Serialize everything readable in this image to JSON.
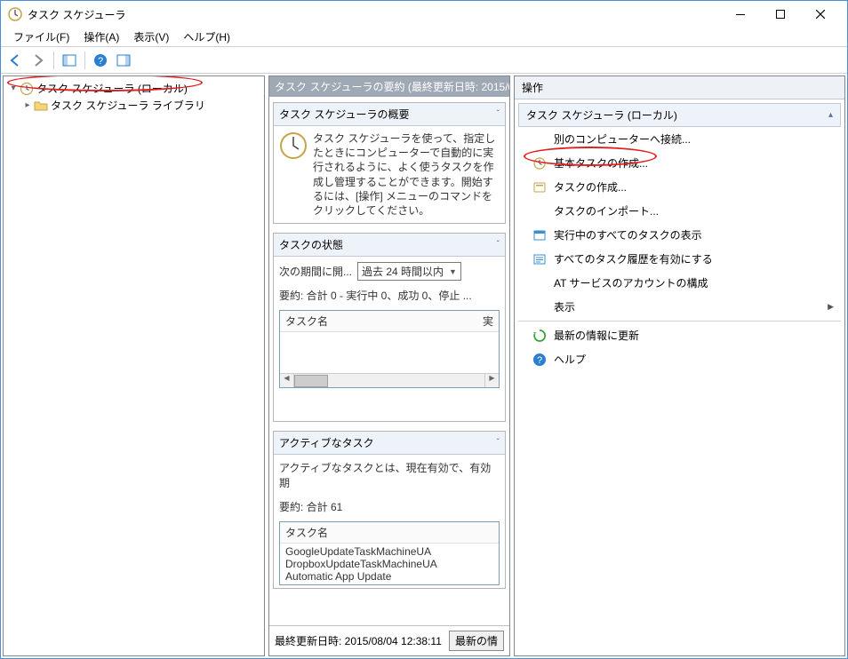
{
  "titlebar": {
    "title": "タスク スケジューラ"
  },
  "menubar": [
    "ファイル(F)",
    "操作(A)",
    "表示(V)",
    "ヘルプ(H)"
  ],
  "tree": {
    "root": {
      "label": "タスク スケジューラ (ローカル)"
    },
    "child": {
      "label": "タスク スケジューラ ライブラリ"
    }
  },
  "center": {
    "header": "タスク スケジューラの要約 (最終更新日時: 2015/08/04",
    "overview_title": "タスク スケジューラの概要",
    "overview_text": "タスク スケジューラを使って、指定したときにコンピューターで自動的に実行されるように、よく使うタスクを作成し管理することができます。開始するには、[操作] メニューのコマンドをクリックしてください。",
    "status_title": "タスクの状態",
    "status_period_label": "次の期間に開...",
    "status_period_value": "過去 24 時間以内",
    "status_summary": "要約: 合計 0 - 実行中 0、成功 0、停止 ...",
    "status_col": "タスク名",
    "status_col2": "実",
    "active_title": "アクティブなタスク",
    "active_desc": "アクティブなタスクとは、現在有効で、有効期",
    "active_summary": "要約: 合計 61",
    "active_col": "タスク名",
    "active_rows": [
      "GoogleUpdateTaskMachineUA",
      "DropboxUpdateTaskMachineUA",
      "Automatic App Update"
    ],
    "footer_label": "最終更新日時: 2015/08/04 12:38:11",
    "footer_btn": "最新の情"
  },
  "actions": {
    "pane_title": "操作",
    "section_title": "タスク スケジューラ (ローカル)",
    "items": [
      {
        "label": "別のコンピューターへ接続...",
        "icon": "none"
      },
      {
        "label": "基本タスクの作成...",
        "icon": "basic-task"
      },
      {
        "label": "タスクの作成...",
        "icon": "task"
      },
      {
        "label": "タスクのインポート...",
        "icon": "none"
      },
      {
        "label": "実行中のすべてのタスクの表示",
        "icon": "running"
      },
      {
        "label": "すべてのタスク履歴を有効にする",
        "icon": "history"
      },
      {
        "label": "AT サービスのアカウントの構成",
        "icon": "none"
      },
      {
        "label": "表示",
        "icon": "none",
        "submenu": true
      },
      {
        "label": "最新の情報に更新",
        "icon": "refresh",
        "sep_before": true
      },
      {
        "label": "ヘルプ",
        "icon": "help"
      }
    ]
  }
}
